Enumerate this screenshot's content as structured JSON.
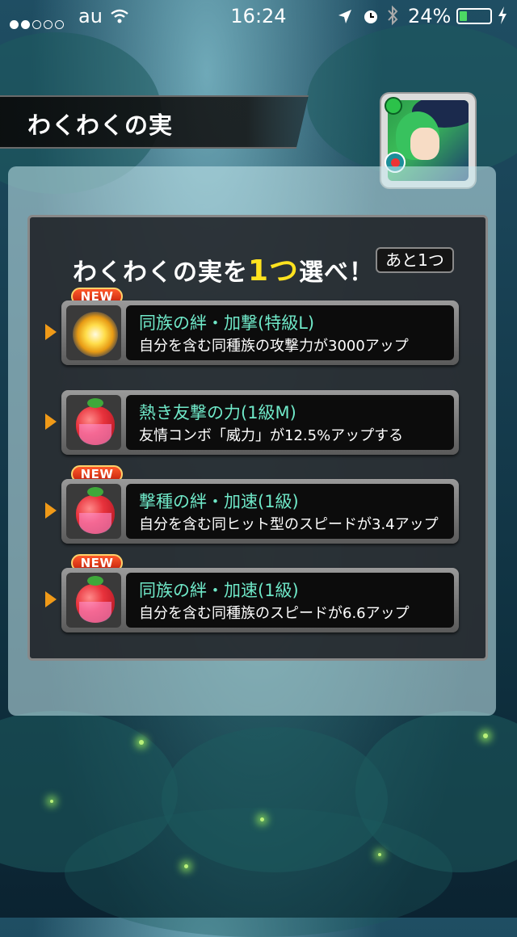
{
  "status_bar": {
    "carrier": "au",
    "time": "16:24",
    "battery_percent": "24%",
    "battery_level": 0.24,
    "signal_bars": 2,
    "icons": [
      "signal-dots-icon",
      "wifi-icon",
      "location-icon",
      "alarm-icon",
      "bluetooth-icon",
      "battery-icon",
      "charging-icon"
    ]
  },
  "header": {
    "title": "わくわくの実"
  },
  "prompt": {
    "before": "わくわくの実を",
    "highlight": "1つ",
    "after": "選べ！",
    "remaining": "あと1つ"
  },
  "new_label": "NEW",
  "options": [
    {
      "name": "同族の絆・加撃(特級L)",
      "description": "自分を含む同種族の攻撃力が3000アップ",
      "is_new": true,
      "icon": "golden-burst-icon"
    },
    {
      "name": "熱き友撃の力(1級M)",
      "description": "友情コンボ「威力」が12.5%アップする",
      "is_new": false,
      "icon": "red-fruit-icon"
    },
    {
      "name": "撃種の絆・加速(1級)",
      "description": "自分を含む同ヒット型のスピードが3.4アップ",
      "is_new": true,
      "icon": "red-fruit-icon"
    },
    {
      "name": "同族の絆・加速(1級)",
      "description": "自分を含む同種族のスピードが6.6アップ",
      "is_new": true,
      "icon": "red-fruit-icon"
    }
  ],
  "colors": {
    "option_name": "#6fe8c8",
    "highlight": "#ffe21f",
    "arrow": "#f09a18",
    "new_badge": "#e33a1a"
  }
}
